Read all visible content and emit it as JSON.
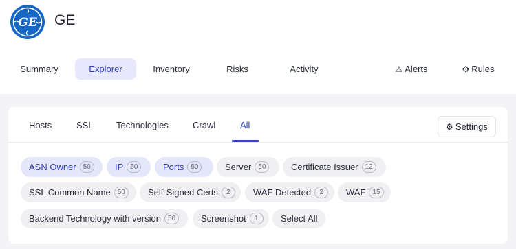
{
  "company": {
    "name": "GE",
    "logo_text": "GE",
    "brand_color": "#1767c4"
  },
  "nav": {
    "items": [
      {
        "label": "Summary",
        "active": false
      },
      {
        "label": "Explorer",
        "active": true
      },
      {
        "label": "Inventory",
        "active": false
      },
      {
        "label": "Risks",
        "active": false
      },
      {
        "label": "Activity",
        "active": false
      }
    ],
    "alerts": {
      "icon": "warning-icon",
      "label": "Alerts"
    },
    "rules": {
      "icon": "gear-icon",
      "label": "Rules"
    }
  },
  "explorer": {
    "tabs": [
      {
        "label": "Hosts",
        "active": false
      },
      {
        "label": "SSL",
        "active": false
      },
      {
        "label": "Technologies",
        "active": false
      },
      {
        "label": "Crawl",
        "active": false
      },
      {
        "label": "All",
        "active": true
      }
    ],
    "settings": {
      "icon": "gear-icon",
      "label": "Settings"
    },
    "chips": [
      {
        "label": "ASN Owner",
        "count": "50",
        "selected": true
      },
      {
        "label": "IP",
        "count": "50",
        "selected": true
      },
      {
        "label": "Ports",
        "count": "50",
        "selected": true
      },
      {
        "label": "Server",
        "count": "50",
        "selected": false
      },
      {
        "label": "Certificate Issuer",
        "count": "12",
        "selected": false
      },
      {
        "label": "SSL Common Name",
        "count": "50",
        "selected": false
      },
      {
        "label": "Self-Signed Certs",
        "count": "2",
        "selected": false
      },
      {
        "label": "WAF Detected",
        "count": "2",
        "selected": false
      },
      {
        "label": "WAF",
        "count": "15",
        "selected": false
      },
      {
        "label": "Backend Technology with version",
        "count": "50",
        "selected": false
      },
      {
        "label": "Screenshot",
        "count": "1",
        "selected": false
      },
      {
        "label": "Select All",
        "count": null,
        "selected": false
      }
    ],
    "accent_color": "#3b46c7"
  }
}
